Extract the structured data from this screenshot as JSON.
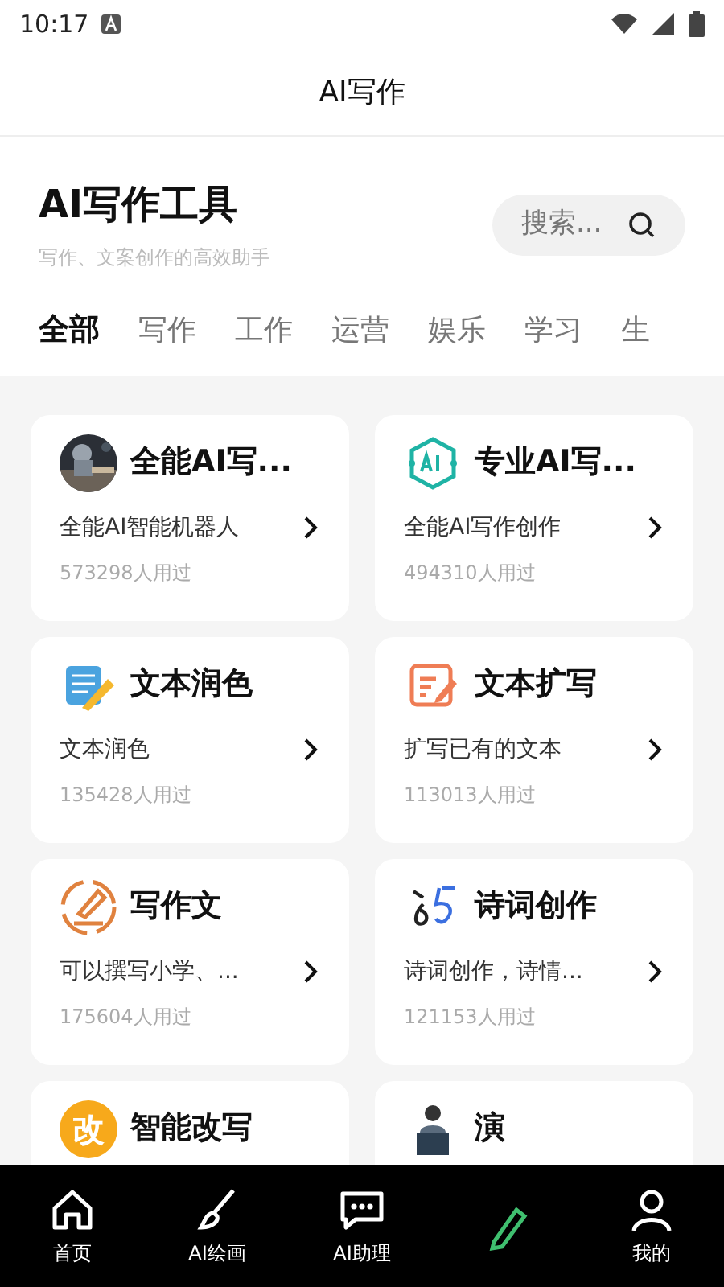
{
  "status_bar": {
    "time": "10:17"
  },
  "header": {
    "title": "AI写作"
  },
  "intro": {
    "title": "AI写作工具",
    "subtitle": "写作、文案创作的高效助手",
    "search": {
      "placeholder": "搜索..."
    }
  },
  "tabs": [
    {
      "label": "全部",
      "selected": true
    },
    {
      "label": "写作",
      "selected": false
    },
    {
      "label": "工作",
      "selected": false
    },
    {
      "label": "运营",
      "selected": false
    },
    {
      "label": "娱乐",
      "selected": false
    },
    {
      "label": "学习",
      "selected": false
    },
    {
      "label": "生",
      "selected": false
    }
  ],
  "cards": [
    {
      "name": "全能AI写...",
      "description": "全能AI智能机器人",
      "usage": "573298人用过"
    },
    {
      "name": "专业AI写...",
      "description": "全能AI写作创作",
      "usage": "494310人用过"
    },
    {
      "name": "文本润色",
      "description": "文本润色",
      "usage": "135428人用过"
    },
    {
      "name": "文本扩写",
      "description": "扩写已有的文本",
      "usage": "113013人用过"
    },
    {
      "name": "写作文",
      "description": "可以撰写小学、...",
      "usage": "175604人用过"
    },
    {
      "name": "诗词创作",
      "description": "诗词创作，诗情...",
      "usage": "121153人用过"
    },
    {
      "name": "智能改写",
      "badge_text": "改"
    },
    {
      "name": "演"
    }
  ],
  "bottom_nav": [
    {
      "label": "首页",
      "selected": false
    },
    {
      "label": "AI绘画",
      "selected": false
    },
    {
      "label": "AI助理",
      "selected": false
    },
    {
      "selected": true
    },
    {
      "label": "我的",
      "selected": false
    }
  ]
}
